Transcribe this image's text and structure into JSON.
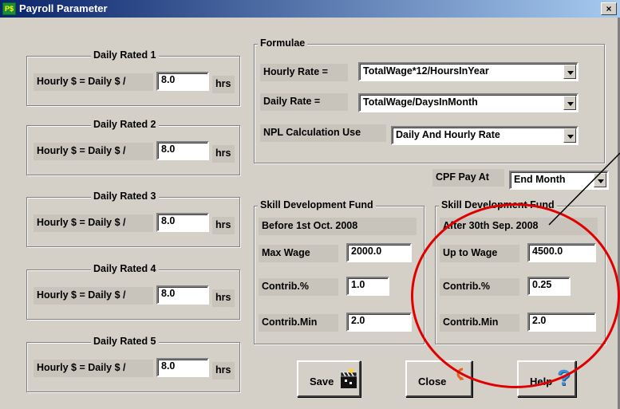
{
  "window": {
    "title": "Payroll Parameter",
    "close_glyph": "×",
    "app_icon": "payroll-app-icon"
  },
  "daily_rated": [
    {
      "title": "Daily Rated 1",
      "label": "Hourly $ = Daily $ /",
      "value": "8.0",
      "unit": "hrs"
    },
    {
      "title": "Daily Rated 2",
      "label": "Hourly $ = Daily $ /",
      "value": "8.0",
      "unit": "hrs"
    },
    {
      "title": "Daily Rated 3",
      "label": "Hourly $ = Daily $ /",
      "value": "8.0",
      "unit": "hrs"
    },
    {
      "title": "Daily Rated 4",
      "label": "Hourly $ = Daily $ /",
      "value": "8.0",
      "unit": "hrs"
    },
    {
      "title": "Daily Rated 5",
      "label": "Hourly $ = Daily $ /",
      "value": "8.0",
      "unit": "hrs"
    }
  ],
  "formulae": {
    "title": "Formulae",
    "hourly_label": "Hourly Rate =",
    "hourly_value": "TotalWage*12/HoursInYear",
    "daily_label": "Daily Rate  =",
    "daily_value": "TotalWage/DaysInMonth",
    "npl_label": "NPL Calculation Use",
    "npl_value": "Daily And Hourly Rate"
  },
  "cpf": {
    "label": "CPF Pay At",
    "value": "End Month"
  },
  "sdf_before": {
    "title": "Skill Development Fund",
    "subtitle": "Before 1st Oct. 2008",
    "max_label": "Max Wage",
    "max_value": "2000.0",
    "pct_label": "Contrib.%",
    "pct_value": "1.0",
    "min_label": "Contrib.Min",
    "min_value": "2.0"
  },
  "sdf_after": {
    "title": "Skill Development Fund",
    "subtitle": "After 30th Sep. 2008",
    "max_label": "Up to Wage",
    "max_value": "4500.0",
    "pct_label": "Contrib.%",
    "pct_value": "0.25",
    "min_label": "Contrib.Min",
    "min_value": "2.0"
  },
  "buttons": {
    "save": "Save",
    "close": "Close",
    "help": "Help",
    "help_glyph": "?"
  },
  "annotation": {
    "color": "#e00000"
  }
}
